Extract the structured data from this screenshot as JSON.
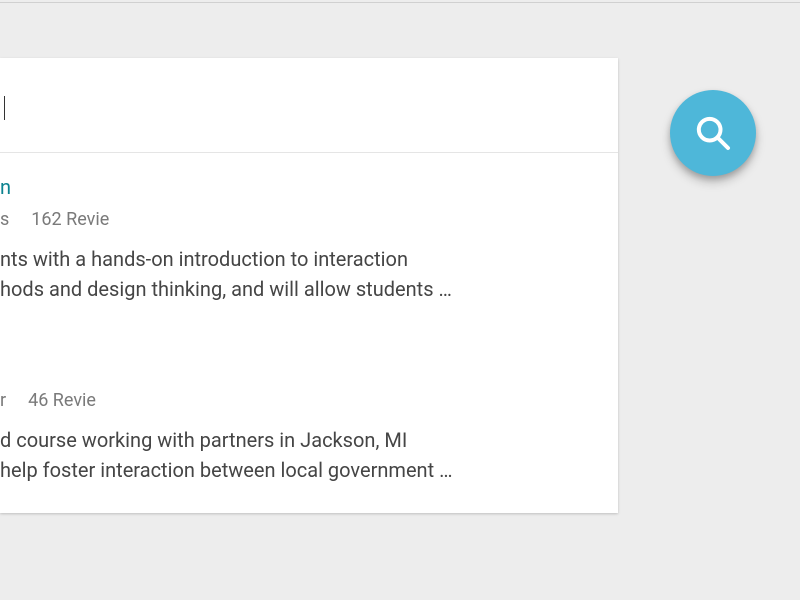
{
  "search_input_value": "",
  "results": [
    {
      "title_fragment": "n",
      "meta_fragment": "s",
      "reviews_fragment": "162 Revie",
      "desc_line1": "nts with a hands-on introduction to interaction",
      "desc_line2": "hods and design thinking, and will allow students …"
    },
    {
      "title_fragment": "",
      "meta_fragment": "r",
      "reviews_fragment": "46 Revie",
      "desc_line1": "d course working with partners in Jackson, MI",
      "desc_line2": "help foster interaction between local government …"
    }
  ],
  "fab_icon": "search-icon"
}
